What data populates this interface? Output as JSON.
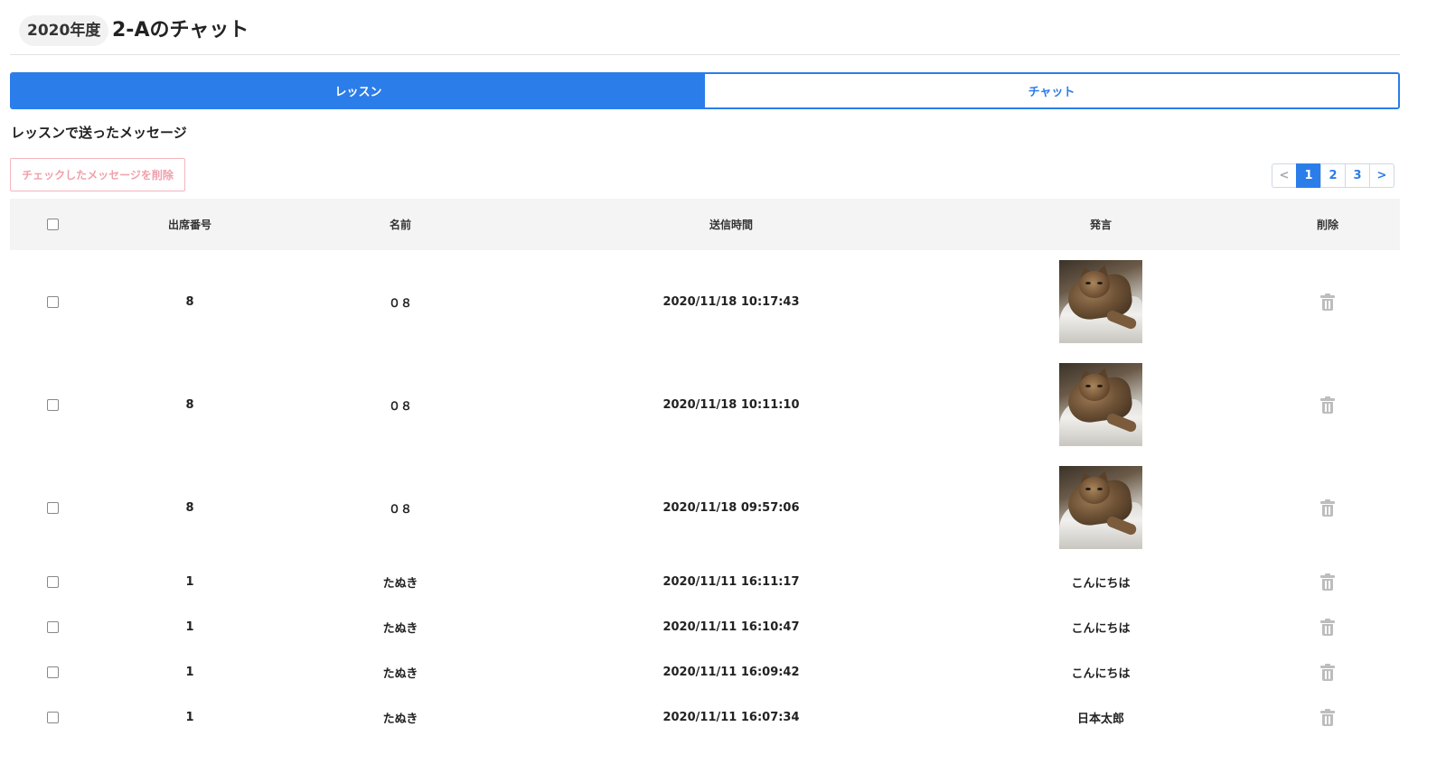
{
  "header": {
    "year_badge": "2020年度",
    "title": "2-Aのチャット"
  },
  "tabs": [
    {
      "label": "レッスン",
      "active": true
    },
    {
      "label": "チャット",
      "active": false
    }
  ],
  "section_title": "レッスンで送ったメッセージ",
  "toolbar": {
    "delete_checked_label": "チェックしたメッセージを削除"
  },
  "pagination": {
    "prev": "<",
    "pages": [
      "1",
      "2",
      "3"
    ],
    "current": "1",
    "next": ">"
  },
  "table": {
    "columns": [
      "出席番号",
      "名前",
      "送信時間",
      "発言",
      "削除"
    ],
    "rows": [
      {
        "number": "8",
        "name": "０８",
        "time": "2020/11/18 10:17:43",
        "message_type": "image",
        "message": ""
      },
      {
        "number": "8",
        "name": "０８",
        "time": "2020/11/18 10:11:10",
        "message_type": "image",
        "message": ""
      },
      {
        "number": "8",
        "name": "０８",
        "time": "2020/11/18 09:57:06",
        "message_type": "image",
        "message": ""
      },
      {
        "number": "1",
        "name": "たぬき",
        "time": "2020/11/11 16:11:17",
        "message_type": "text",
        "message": "こんにちは"
      },
      {
        "number": "1",
        "name": "たぬき",
        "time": "2020/11/11 16:10:47",
        "message_type": "text",
        "message": "こんにちは"
      },
      {
        "number": "1",
        "name": "たぬき",
        "time": "2020/11/11 16:09:42",
        "message_type": "text",
        "message": "こんにちは"
      },
      {
        "number": "1",
        "name": "たぬき",
        "time": "2020/11/11 16:07:34",
        "message_type": "text",
        "message": "日本太郎"
      }
    ]
  },
  "icons": {
    "row_image": "cat-photo-thumbnail",
    "delete": "trash-icon",
    "select": "checkbox"
  },
  "colors": {
    "accent": "#2b7de9",
    "danger_outline": "#f5b5bd",
    "header_bg": "#f4f4f4",
    "icon_gray": "#bdbdbd"
  }
}
